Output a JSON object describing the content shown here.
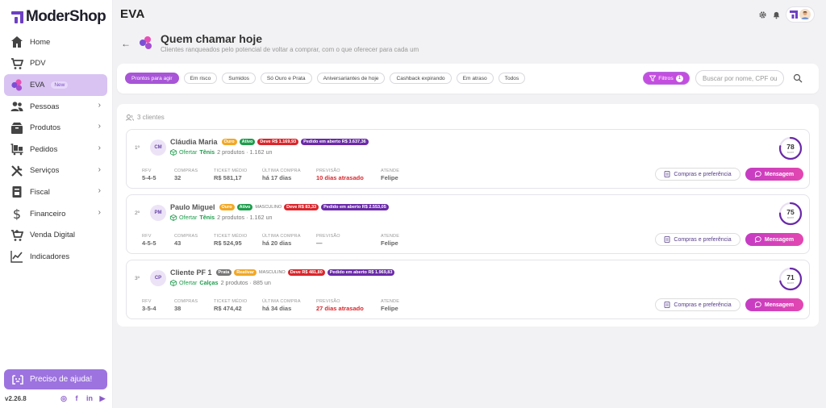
{
  "app": {
    "brand": "ModerShop",
    "version": "v2.26.8",
    "accent": "#8b5cc9"
  },
  "sidebar": {
    "items": [
      {
        "label": "Home",
        "icon": "home-icon"
      },
      {
        "label": "PDV",
        "icon": "cart-icon"
      },
      {
        "label": "EVA",
        "icon": "eva-icon",
        "badge": "New",
        "active": true
      },
      {
        "label": "Pessoas",
        "icon": "people-icon",
        "chevron": true
      },
      {
        "label": "Produtos",
        "icon": "box-icon",
        "chevron": true
      },
      {
        "label": "Pedidos",
        "icon": "orders-icon",
        "chevron": true
      },
      {
        "label": "Serviços",
        "icon": "tools-icon",
        "chevron": true
      },
      {
        "label": "Fiscal",
        "icon": "fiscal-icon",
        "chevron": true
      },
      {
        "label": "Financeiro",
        "icon": "dollar-icon",
        "chevron": true
      },
      {
        "label": "Venda Digital",
        "icon": "digital-cart-icon"
      },
      {
        "label": "Indicadores",
        "icon": "chart-icon"
      }
    ],
    "help_label": "Preciso de ajuda!",
    "socials": [
      "instagram-icon",
      "facebook-icon",
      "linkedin-icon",
      "youtube-icon"
    ]
  },
  "topbar": {
    "title": "EVA"
  },
  "page": {
    "title": "Quem chamar hoje",
    "subtitle": "Clientes ranqueados pelo potencial de voltar a comprar, com o que oferecer para cada um"
  },
  "filters": {
    "chips": [
      "Prontos para agir",
      "Em risco",
      "Sumidos",
      "Só Ouro e Prata",
      "Aniversariantes de hoje",
      "Cashback expirando",
      "Em atraso",
      "Todos"
    ],
    "active_chip": 0,
    "filtros_label": "Filtros",
    "filtros_count": "1",
    "search_placeholder": "Buscar por nome, CPF ou"
  },
  "list": {
    "count_label": "3 clientes",
    "stat_headers": {
      "rfv": "RFV",
      "compras": "COMPRAS",
      "ticket": "TICKET MÉDIO",
      "ultima": "ÚLTIMA COMPRA",
      "previsao": "PREVISÃO",
      "atende": "ATENDE"
    },
    "offer_label": "Ofertar",
    "score_label": "score",
    "compras_btn": "Compras e preferência",
    "msg_btn": "Mensagem",
    "customers": [
      {
        "rank": "1º",
        "initials": "CM",
        "name": "Cláudia Maria",
        "tags": [
          {
            "text": "Ouro",
            "kind": "ouro"
          },
          {
            "text": "Ativo",
            "kind": "ativo"
          },
          {
            "text": "Deve R$ 1.169,93",
            "kind": "deve"
          },
          {
            "text": "Pedido em aberto R$ 3.637,36",
            "kind": "pedido"
          }
        ],
        "offer": "Tênis",
        "offer_detail": "2 produtos · 1.162 un",
        "rfv": "5-4-5",
        "compras": "32",
        "ticket": "R$ 581,17",
        "ultima": "há 17 dias",
        "previsao": "10 dias atrasado",
        "previsao_late": true,
        "atende": "Felipe",
        "score": 78
      },
      {
        "rank": "2º",
        "initials": "PM",
        "name": "Paulo Miguel",
        "tags": [
          {
            "text": "Ouro",
            "kind": "ouro"
          },
          {
            "text": "Ativo",
            "kind": "ativo"
          },
          {
            "text": "MASCULINO",
            "kind": "plain"
          },
          {
            "text": "Deve R$ 83,33",
            "kind": "deve"
          },
          {
            "text": "Pedido em aberto R$ 2.553,05",
            "kind": "pedido"
          }
        ],
        "offer": "Tênis",
        "offer_detail": "2 produtos · 1.162 un",
        "rfv": "4-5-5",
        "compras": "43",
        "ticket": "R$ 524,95",
        "ultima": "há 20 dias",
        "previsao": "—",
        "previsao_late": false,
        "atende": "Felipe",
        "score": 75
      },
      {
        "rank": "3º",
        "initials": "CP",
        "name": "Cliente PF 1",
        "tags": [
          {
            "text": "Prata",
            "kind": "prata"
          },
          {
            "text": "Reativar",
            "kind": "reativar"
          },
          {
            "text": "MASCULINO",
            "kind": "plain"
          },
          {
            "text": "Deve R$ 481,80",
            "kind": "deve"
          },
          {
            "text": "Pedido em aberto R$ 1.969,83",
            "kind": "pedido"
          }
        ],
        "offer": "Calças",
        "offer_detail": "2 produtos · 885 un",
        "rfv": "3-5-4",
        "compras": "38",
        "ticket": "R$ 474,42",
        "ultima": "há 34 dias",
        "previsao": "27 dias atrasado",
        "previsao_late": true,
        "atende": "Felipe",
        "score": 71
      }
    ]
  }
}
